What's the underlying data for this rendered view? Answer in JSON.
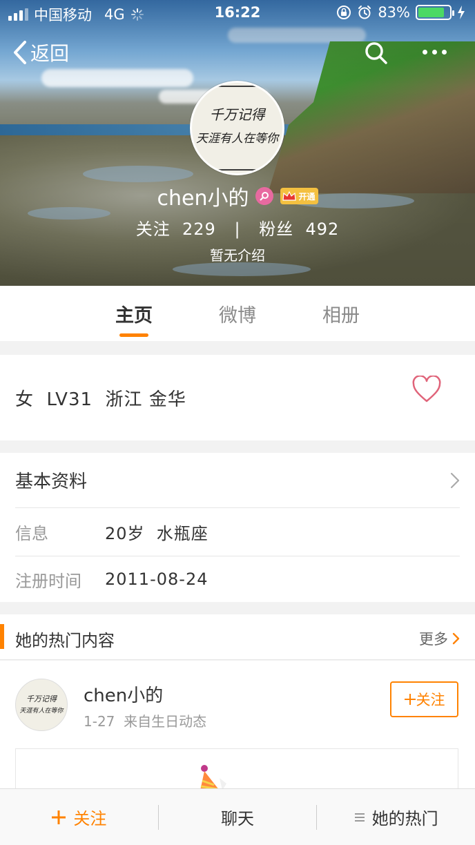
{
  "status_bar": {
    "carrier": "中国移动",
    "network": "4G",
    "time": "16:22",
    "battery": "83%",
    "battery_level": 0.83
  },
  "nav": {
    "back_label": "返回"
  },
  "profile": {
    "avatar_line1": "千万记得",
    "avatar_line2": "天涯有人在等你",
    "name": "chen小的",
    "vip_label": "开通",
    "following_label": "关注",
    "following_count": "229",
    "separator": "|",
    "followers_label": "粉丝",
    "followers_count": "492",
    "intro": "暂无介绍"
  },
  "tabs": [
    {
      "label": "主页",
      "active": true
    },
    {
      "label": "微博",
      "active": false
    },
    {
      "label": "相册",
      "active": false
    }
  ],
  "tags_line": "女  LV31  浙江 金华",
  "basic_info": {
    "title": "基本资料",
    "rows": [
      {
        "label": "信息",
        "value": "20岁  水瓶座"
      },
      {
        "label": "注册时间",
        "value": "2011-08-24"
      }
    ]
  },
  "hot": {
    "title": "她的热门内容",
    "more": "更多"
  },
  "post": {
    "author": "chen小的",
    "meta": "1-27  来自生日动态",
    "follow_label": "关注"
  },
  "bottom_bar": {
    "follow": "关注",
    "chat": "聊天",
    "hot": "她的热门"
  },
  "colors": {
    "accent": "#ff8200",
    "heart": "#e0647a",
    "badge_pink": "#e86aa0",
    "vip_gold": "#f4c040"
  }
}
